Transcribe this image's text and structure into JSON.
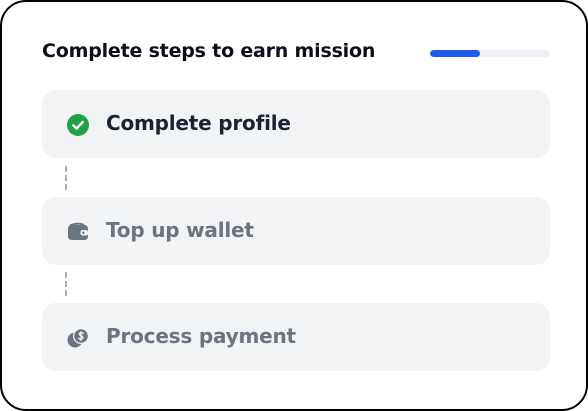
{
  "header": {
    "title": "Complete steps to earn mission",
    "progress_fraction": 0.42
  },
  "colors": {
    "accent": "#1f5bf0",
    "success": "#1fa24a",
    "muted_icon": "#6c7480"
  },
  "steps": [
    {
      "label": "Complete profile",
      "status": "completed",
      "icon": "check-circle-icon"
    },
    {
      "label": "Top up wallet",
      "status": "pending",
      "icon": "wallet-icon"
    },
    {
      "label": "Process payment",
      "status": "pending",
      "icon": "coins-icon"
    }
  ]
}
